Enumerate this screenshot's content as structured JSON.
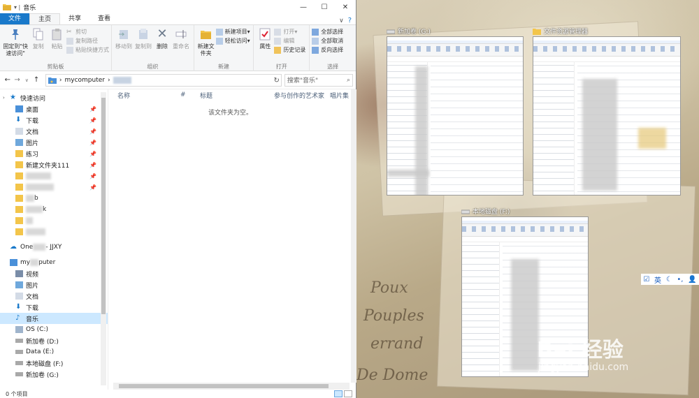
{
  "window": {
    "title": "音乐",
    "tabs": [
      "文件",
      "主页",
      "共享",
      "查看"
    ],
    "active_tab": "主页"
  },
  "ribbon": {
    "clipboard": {
      "group_name": "剪贴板",
      "pin_label": "固定到\"快速访问\"",
      "copy_label": "复制",
      "paste_label": "粘贴",
      "cut_label": "剪切",
      "copy_path_label": "复制路径",
      "paste_shortcut_label": "粘贴快捷方式"
    },
    "organize": {
      "group_name": "组织",
      "move_to_label": "移动到",
      "copy_to_label": "复制到",
      "delete_label": "删除",
      "rename_label": "重命名"
    },
    "new": {
      "group_name": "新建",
      "new_folder_label": "新建文件夹",
      "new_item_label": "新建项目",
      "easy_access_label": "轻松访问"
    },
    "open": {
      "group_name": "打开",
      "properties_label": "属性",
      "open_label": "打开",
      "edit_label": "编辑",
      "history_label": "历史记录"
    },
    "select": {
      "group_name": "选择",
      "select_all_label": "全部选择",
      "select_none_label": "全部取消",
      "invert_label": "反向选择"
    }
  },
  "address": {
    "path_root": "mycomputer",
    "search_placeholder": "搜索\"音乐\""
  },
  "nav": {
    "quick_access": "快速访问",
    "quick_items": [
      "桌面",
      "下载",
      "文档",
      "图片",
      "练习",
      "新建文件夹111"
    ],
    "partial_b": "b",
    "partial_k": "k",
    "onedrive": "One",
    "onedrive_tail": " - JJXY",
    "pc_head": "my",
    "pc_tail": "puter",
    "pc_items": [
      "视频",
      "图片",
      "文档",
      "下载",
      "音乐"
    ],
    "drives": [
      "OS (C:)",
      "新加卷 (D:)",
      "Data (E:)",
      "本地磁盘 (F:)",
      "新加卷 (G:)"
    ]
  },
  "columns": [
    "名称",
    "#",
    "标题",
    "参与创作的艺术家",
    "唱片集"
  ],
  "empty_message": "该文件夹为空。",
  "status": {
    "item_count": "0 个项目"
  },
  "thumbnails": [
    {
      "label": "新加卷 (G:)"
    },
    {
      "label": "文件资源管理器"
    },
    {
      "label": "本地磁盘 (F:)"
    }
  ],
  "tray": {
    "lang": "英"
  },
  "watermark": {
    "brand": "Bai 经验",
    "url": "jingyan.baidu.com"
  },
  "colors": {
    "accent": "#1979ca",
    "selection": "#cce8ff",
    "folder": "#f3c54a"
  }
}
